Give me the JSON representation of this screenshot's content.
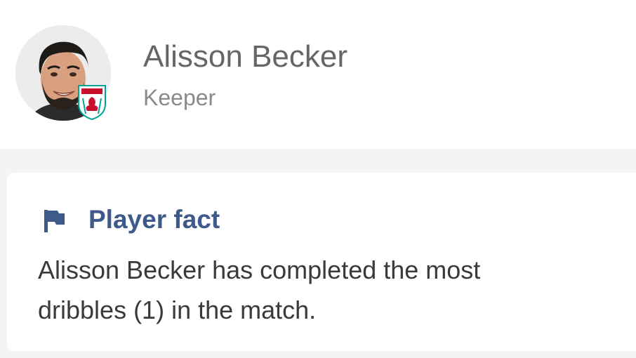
{
  "player": {
    "name": "Alisson Becker",
    "position": "Keeper",
    "avatar_icon": "player-photo",
    "badge_icon": "club-crest-badge"
  },
  "fact_card": {
    "icon": "flag-icon",
    "title": "Player fact",
    "text": "Alisson Becker has completed the most dribbles (1) in the match."
  },
  "colors": {
    "accent": "#3d5a8a",
    "badge_red": "#c8102e",
    "badge_teal": "#00a398"
  }
}
